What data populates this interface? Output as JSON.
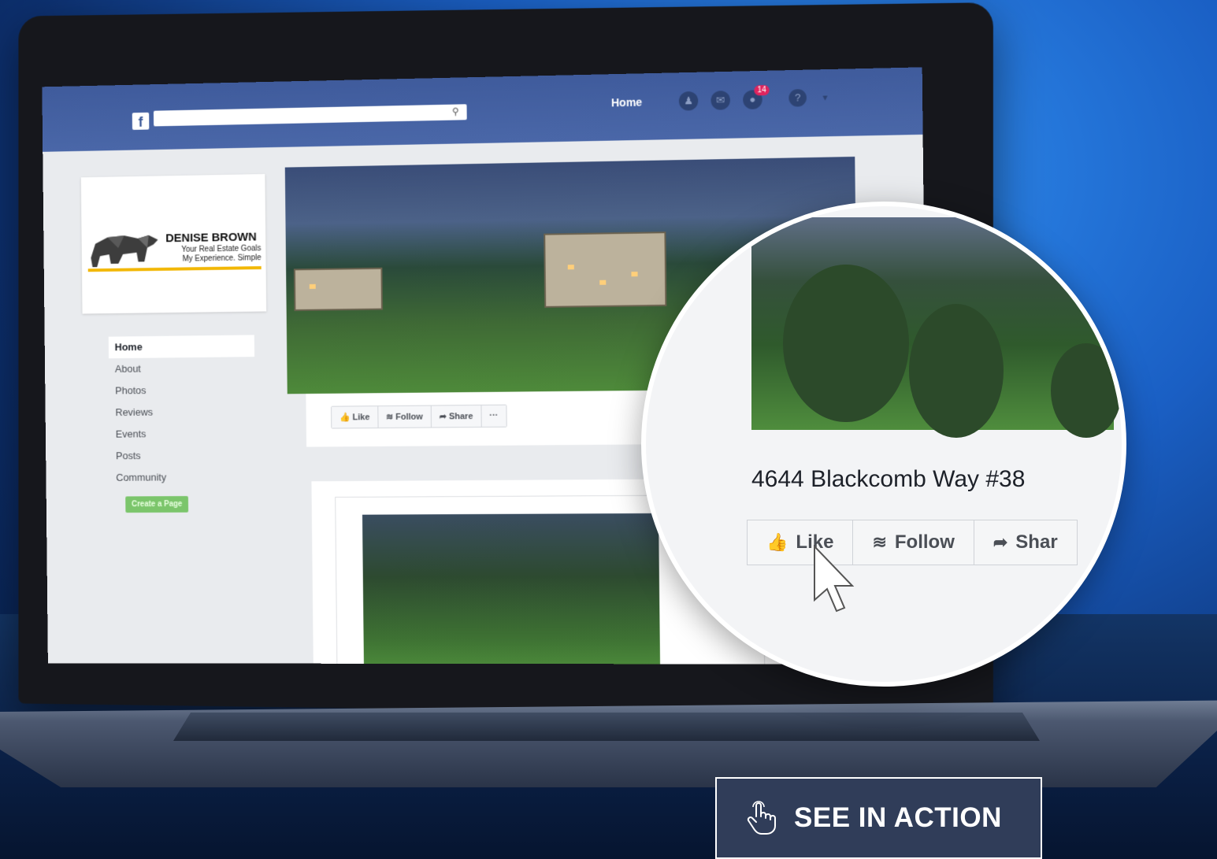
{
  "colors": {
    "facebook_blue": "#3b5998",
    "background_blue": "#1a5fc4",
    "cta_background": "#303d59",
    "brand_accent": "#f2b705",
    "create_page_green": "#7bc56b",
    "notification_red": "#e0245e"
  },
  "topbar": {
    "logo": "f",
    "home_label": "Home",
    "notification_count": "14",
    "icons": [
      "friends-icon",
      "messenger-icon",
      "globe-icon",
      "help-icon",
      "caret-down-icon"
    ]
  },
  "profile": {
    "name": "DENISE BROWN",
    "tagline_1": "Your Real Estate Goals",
    "tagline_2": "My Experience. Simple"
  },
  "sidebar": {
    "items": [
      {
        "label": "Home"
      },
      {
        "label": "About"
      },
      {
        "label": "Photos"
      },
      {
        "label": "Reviews"
      },
      {
        "label": "Events"
      },
      {
        "label": "Posts"
      },
      {
        "label": "Community"
      }
    ],
    "create_page_label": "Create a Page"
  },
  "cover_actions": {
    "like": "Like",
    "follow": "Follow",
    "share": "Share",
    "more": "···"
  },
  "zoom": {
    "address": "4644 Blackcomb Way #38",
    "like": "Like",
    "follow": "Follow",
    "share": "Shar"
  },
  "cta": {
    "label": "SEE IN ACTION",
    "icon": "pointing-hand-icon"
  }
}
